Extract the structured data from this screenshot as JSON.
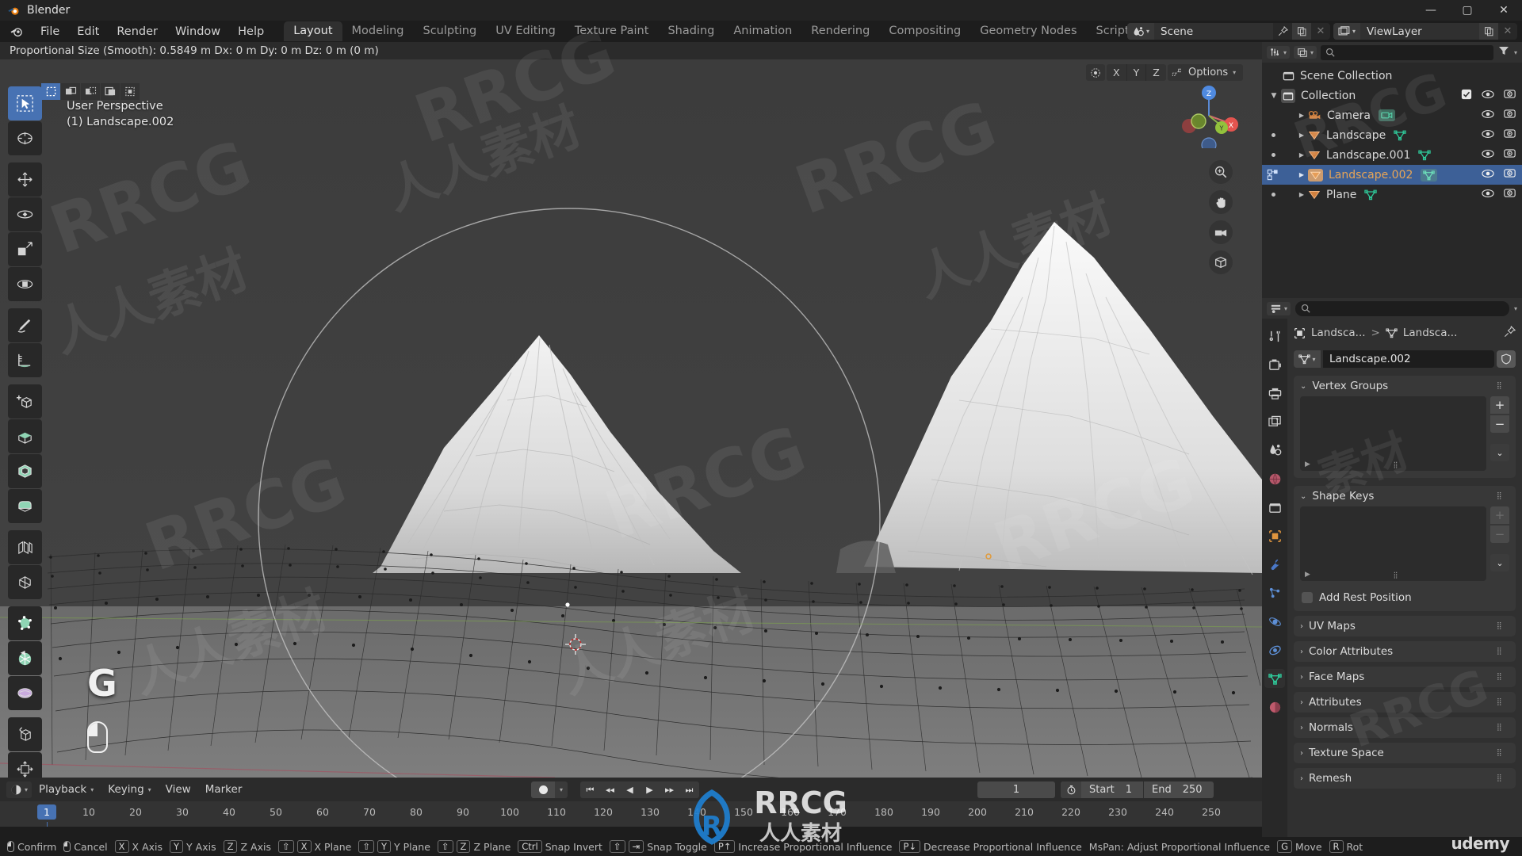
{
  "window": {
    "title": "Blender",
    "controls": {
      "minimize": "—",
      "maximize": "▢",
      "close": "✕"
    }
  },
  "topbar": {
    "menus": [
      "File",
      "Edit",
      "Render",
      "Window",
      "Help"
    ],
    "workspaces": [
      {
        "label": "Layout",
        "active": true
      },
      {
        "label": "Modeling",
        "active": false
      },
      {
        "label": "Sculpting",
        "active": false
      },
      {
        "label": "UV Editing",
        "active": false
      },
      {
        "label": "Texture Paint",
        "active": false
      },
      {
        "label": "Shading",
        "active": false
      },
      {
        "label": "Animation",
        "active": false
      },
      {
        "label": "Rendering",
        "active": false
      },
      {
        "label": "Compositing",
        "active": false
      },
      {
        "label": "Geometry Nodes",
        "active": false
      },
      {
        "label": "Scripting",
        "active": false
      }
    ],
    "add_workspace": "+",
    "scene": {
      "name": "Scene",
      "icon": "scene-icon"
    },
    "view_layer": {
      "name": "ViewLayer",
      "icon": "view-layer-icon"
    }
  },
  "viewport": {
    "status_text": "Proportional Size (Smooth): 0.5849 m   Dx: 0 m   Dy: 0 m   Dz: 0 m (0 m)",
    "view_label": "User Perspective",
    "active_object_label": "(1) Landscape.002",
    "header": {
      "snap_axes": [
        "X",
        "Y",
        "Z"
      ],
      "options_label": "Options"
    },
    "select_modes": [
      "set",
      "extend",
      "subtract",
      "invert",
      "intersect"
    ],
    "tools": [
      "tweak-select-tool",
      "cursor-tool",
      "move-tool",
      "rotate-tool",
      "scale-tool",
      "transform-tool",
      "annotate-tool",
      "measure-tool",
      "add-cube-tool",
      "extrude-region-tool",
      "inset-faces-tool",
      "bevel-tool",
      "loop-cut-tool",
      "knife-tool",
      "poly-build-tool",
      "spin-tool",
      "smooth-tool",
      "shear-tool",
      "shrink-fatten-tool"
    ],
    "hud": {
      "key": "G",
      "mouse_hint": "left-mouse"
    }
  },
  "timeline": {
    "menus": [
      "Playback",
      "Keying",
      "View",
      "Marker"
    ],
    "current_frame": "1",
    "start_label": "Start",
    "start_value": "1",
    "end_label": "End",
    "end_value": "250",
    "ticks": [
      "1",
      "10",
      "20",
      "30",
      "40",
      "50",
      "60",
      "70",
      "80",
      "90",
      "100",
      "110",
      "120",
      "130",
      "140",
      "150",
      "160",
      "170",
      "180",
      "190",
      "200",
      "210",
      "220",
      "230",
      "240",
      "250"
    ]
  },
  "outliner": {
    "rows": [
      {
        "label": "Scene Collection",
        "depth": 0,
        "icon": "collection-icon",
        "selected": false,
        "has_disclosure": false,
        "visible": false,
        "render": false,
        "checkbox": false,
        "dot": false
      },
      {
        "label": "Collection",
        "depth": 1,
        "icon": "collection-icon",
        "selected": false,
        "has_disclosure": true,
        "visible": true,
        "render": true,
        "checkbox": true,
        "dot": false
      },
      {
        "label": "Camera",
        "depth": 2,
        "icon": "camera-icon",
        "data_icon": "camera-data-icon",
        "selected": false,
        "has_disclosure": true,
        "visible": true,
        "render": true,
        "checkbox": false,
        "dot": false
      },
      {
        "label": "Landscape",
        "depth": 2,
        "icon": "mesh-object-icon",
        "data_icon": "mesh-data-icon",
        "selected": false,
        "has_disclosure": true,
        "visible": true,
        "render": true,
        "checkbox": false,
        "dot": true
      },
      {
        "label": "Landscape.001",
        "depth": 2,
        "icon": "mesh-object-icon",
        "data_icon": "mesh-data-icon",
        "selected": false,
        "has_disclosure": true,
        "visible": true,
        "render": true,
        "checkbox": false,
        "dot": true
      },
      {
        "label": "Landscape.002",
        "depth": 2,
        "icon": "mesh-object-icon",
        "data_icon": "mesh-data-icon",
        "selected": true,
        "has_disclosure": true,
        "visible": true,
        "render": true,
        "checkbox": false,
        "dot": false
      },
      {
        "label": "Plane",
        "depth": 2,
        "icon": "mesh-object-icon",
        "data_icon": "mesh-data-icon",
        "selected": false,
        "has_disclosure": true,
        "visible": true,
        "render": true,
        "checkbox": false,
        "dot": true
      }
    ]
  },
  "properties": {
    "breadcrumb": [
      "Landsca...",
      "Landsca..."
    ],
    "datablock_name": "Landscape.002",
    "tabs": [
      "tool-tab",
      "render-tab",
      "output-tab",
      "view-layer-tab",
      "scene-tab",
      "world-tab",
      "collection-tab",
      "object-tab",
      "modifier-tab",
      "particles-tab",
      "physics-tab",
      "constraints-tab",
      "object-data-tab",
      "material-tab"
    ],
    "active_tab_index": 12,
    "panels": [
      {
        "label": "Vertex Groups",
        "open": true,
        "type": "list",
        "add_enabled": true
      },
      {
        "label": "Shape Keys",
        "open": true,
        "type": "list",
        "add_enabled": false
      }
    ],
    "checkbox_label": "Add Rest Position",
    "collapsed_panels": [
      "UV Maps",
      "Color Attributes",
      "Face Maps",
      "Attributes",
      "Normals",
      "Texture Space",
      "Remesh"
    ]
  },
  "statusbar": {
    "items": [
      {
        "keys": [
          "mouse-left"
        ],
        "label": "Confirm"
      },
      {
        "keys": [
          "mouse-right"
        ],
        "label": "Cancel"
      },
      {
        "keys": [
          "X"
        ],
        "label": "X Axis"
      },
      {
        "keys": [
          "Y"
        ],
        "label": "Y Axis"
      },
      {
        "keys": [
          "Z"
        ],
        "label": "Z Axis"
      },
      {
        "keys": [
          "⇧",
          "X"
        ],
        "label": "X Plane"
      },
      {
        "keys": [
          "⇧",
          "Y"
        ],
        "label": "Y Plane"
      },
      {
        "keys": [
          "⇧",
          "Z"
        ],
        "label": "Z Plane"
      },
      {
        "keys": [
          "Ctrl"
        ],
        "label": "Snap Invert"
      },
      {
        "keys": [
          "⇧",
          "⇥"
        ],
        "label": "Snap Toggle"
      },
      {
        "keys": [
          "P↑"
        ],
        "label": "Increase Proportional Influence"
      },
      {
        "keys": [
          "P↓"
        ],
        "label": "Decrease Proportional Influence"
      },
      {
        "keys": [],
        "label": "MsPan: Adjust Proportional Influence"
      },
      {
        "keys": [
          "G"
        ],
        "label": "Move"
      },
      {
        "keys": [
          "R"
        ],
        "label": "Rot"
      }
    ],
    "branding": "udemy"
  },
  "watermarks": {
    "diagonal": [
      "RRCG",
      "人人素材",
      "RRCG",
      "人人素材",
      "RRCG",
      "人人素材"
    ],
    "center_logo": "RRCG"
  },
  "colors": {
    "accent_blue": "#4772b3",
    "selected_name": "#e8a556",
    "mesh_orange": "#e07a3a",
    "mesh_green": "#3ec9a0",
    "background": "#1d1d1d",
    "viewport_bg": "#3b3b3b"
  }
}
